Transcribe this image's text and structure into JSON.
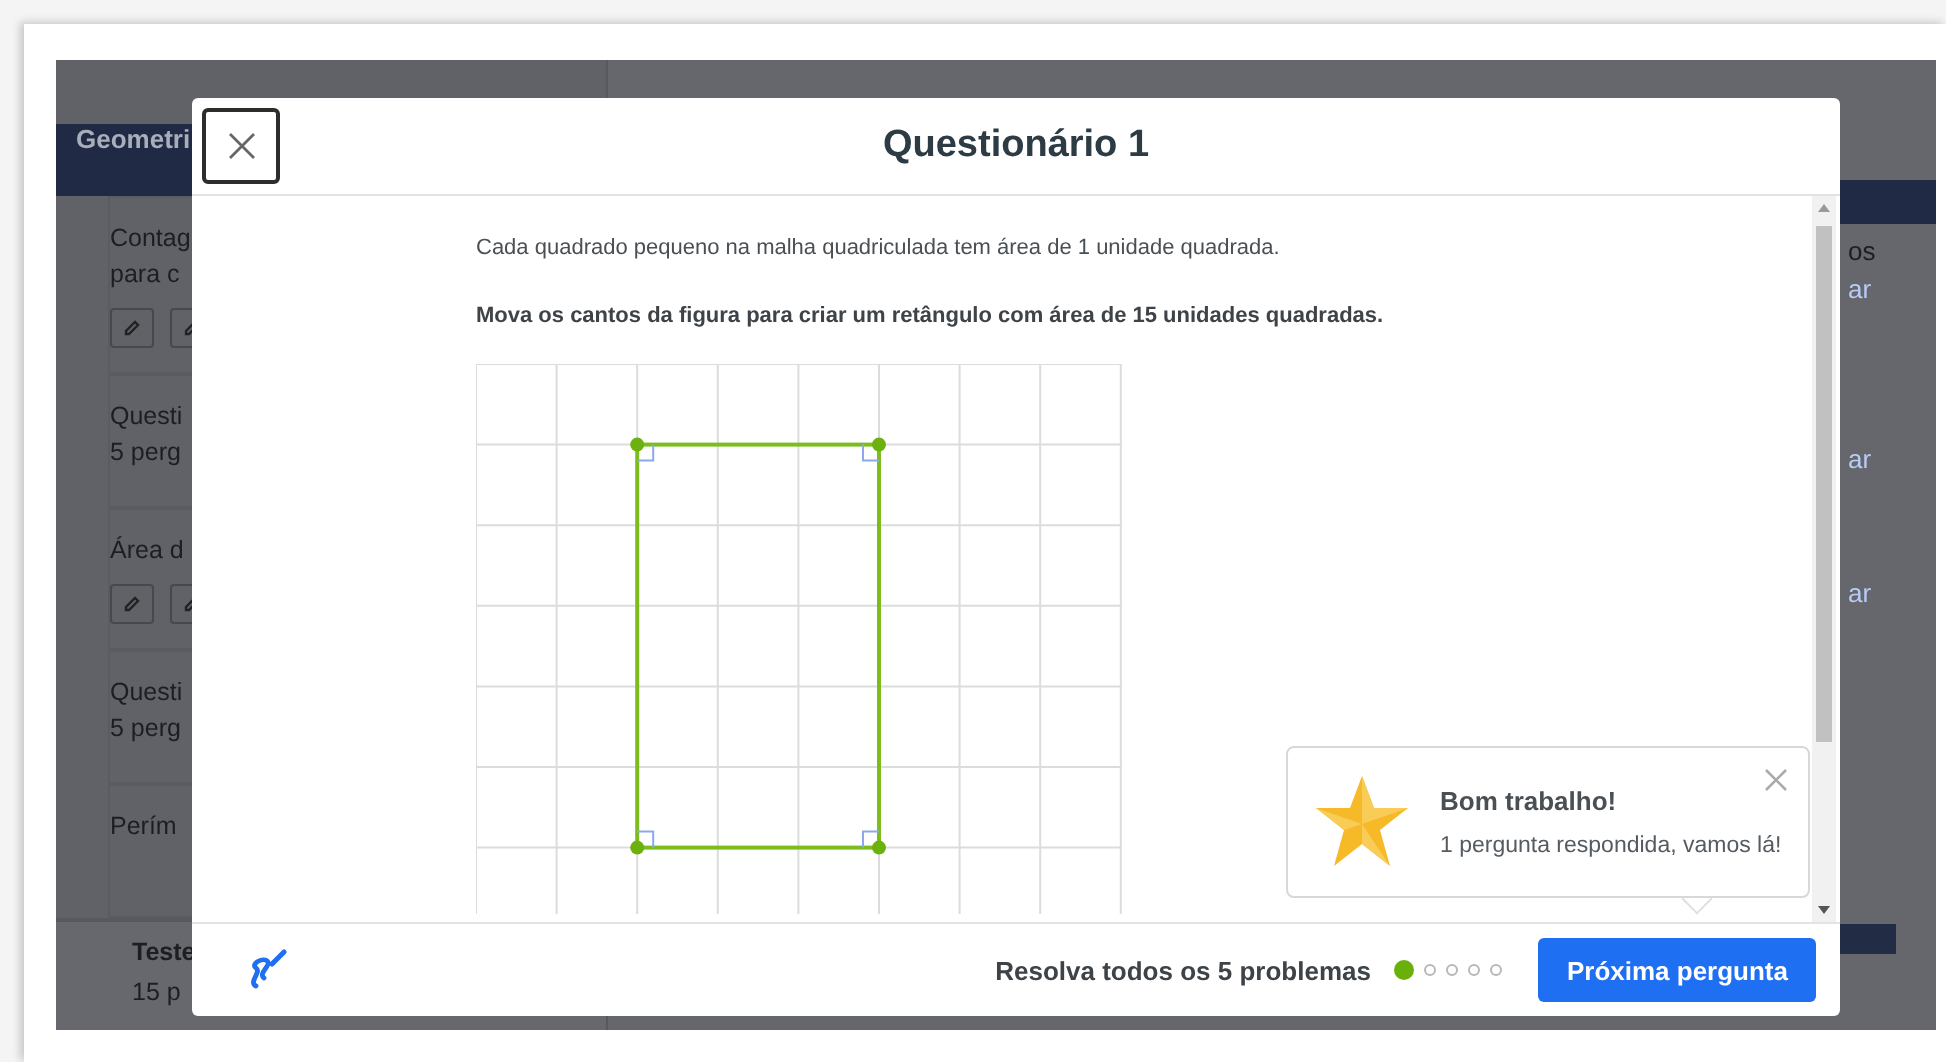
{
  "background": {
    "sidebar": {
      "title": "Geometri",
      "items": [
        {
          "title": "Contag",
          "subtitle": "para c",
          "tools": true
        },
        {
          "title": "Questi",
          "subtitle": "5 perg",
          "tools": false
        },
        {
          "title": "Área d",
          "tools": true
        },
        {
          "title": "Questi",
          "subtitle": "5 perg",
          "tools": false
        },
        {
          "title": "Perím",
          "tools": false
        }
      ],
      "footer": {
        "title": "Teste",
        "subtitle": "15 p"
      }
    },
    "right_fragments": [
      "os",
      "ar",
      "ar",
      "ar"
    ]
  },
  "dialog": {
    "title": "Questionário 1",
    "instructions": [
      "Cada quadrado pequeno na malha quadriculada tem área de 1 unidade quadrada.",
      "Mova os cantos da figura para criar um retângulo com área de 15 unidades quadradas."
    ],
    "toast": {
      "title": "Bom trabalho!",
      "message": "1 pergunta respondida, vamos lá!"
    },
    "footer": {
      "progress_label": "Resolva todos os 5 problemas",
      "steps": [
        {
          "done": true
        },
        {
          "done": false
        },
        {
          "done": false
        },
        {
          "done": false
        },
        {
          "done": false
        }
      ],
      "next_button": "Próxima pergunta"
    }
  }
}
